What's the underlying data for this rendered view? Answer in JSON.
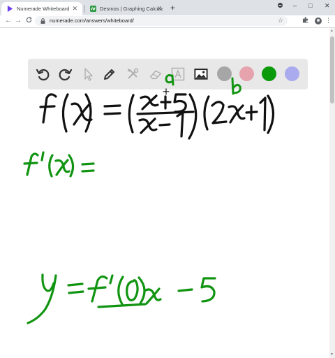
{
  "browser": {
    "tabs": [
      {
        "title": "Numerade Whiteboard",
        "active": true,
        "favicon": "numerade-logo-icon"
      },
      {
        "title": "Desmos | Graphing Calculator",
        "active": false,
        "favicon": "desmos-logo-icon"
      }
    ],
    "new_tab_label": "+",
    "window_controls": {
      "minimize": "–",
      "maximize": "□",
      "close": "✕"
    },
    "nav": {
      "back": "←",
      "forward": "→",
      "reload": "C"
    },
    "url": "numerade.com/answers/whiteboard/",
    "icons": [
      "lock-icon",
      "star-icon",
      "extensions-icon",
      "profile-avatar-icon",
      "menu-icon"
    ]
  },
  "whiteboard": {
    "tools": [
      "undo-icon",
      "redo-icon",
      "pointer-icon",
      "pen-icon",
      "tools-icon",
      "eraser-icon",
      "text-icon",
      "image-icon"
    ],
    "colors": [
      "#a6a6a6",
      "#e7a3ad",
      "#0a9a0a",
      "#aaaaee"
    ],
    "selected_color": "#0a9a0a",
    "ink": {
      "black": "#111111",
      "green": "#119411"
    },
    "handwriting": [
      "f(x) = ((x+5)/(x-1))(2x+1)",
      "a",
      "b",
      "f'(x) =",
      "y = f'(0)x - 5"
    ]
  }
}
